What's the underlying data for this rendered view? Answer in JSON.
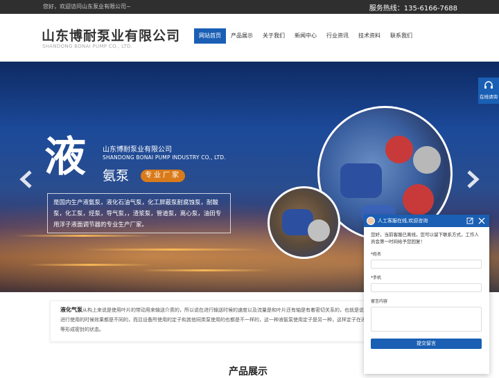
{
  "topbar": {
    "welcome": "您好，欢迎访问山东泵业有限公司~",
    "hotline": "服务热线：135-6166-7688"
  },
  "logo": {
    "cn": "山东博耐泵业有限公司",
    "en": "SHANDONG BONAI PUMP CO., LTD."
  },
  "nav": {
    "items": [
      "网站首页",
      "产品展示",
      "关于我们",
      "新闻中心",
      "行业资讯",
      "技术资料",
      "联系我们"
    ]
  },
  "banner": {
    "big_char": "液",
    "company_cn": "山东博耐泵业有限公司",
    "company_en": "SHANDONG BONAI PUMP INDUSTRY CO., LTD.",
    "subtitle": "氨泵",
    "badge": "专业厂家",
    "description": "是国内生产液氨泵，液化石油气泵，化工屏蔽泵耐腐蚀泵，耐酸泵，化工泵，烃泵，导气泵，，渣浆泵，管道泵，离心泵，油田专用浮子液面调节器的专业生产厂家。"
  },
  "side_service": {
    "label": "在线请询"
  },
  "intro": {
    "keyword": "液化气泵",
    "text": "从构上来说是使用叶片的带动用来输送介质的，所以说在进行输送时候的速度以及流量是和叶片还有轴是有着密切关系的，也就是说叶片或者是不同性质的叶片在进行使用的时候效果都是不同的，而且设备所使用的定子和其他同类泵使用的也都是不一样的，这一种液氨泵使用定子是另一种，这样定子在进行使用的时候就可以和转子等形成密封的状态。"
  },
  "section": {
    "title": "产品展示"
  },
  "chat": {
    "header": "人工客服在线,欢迎咨询",
    "note": "您好，当前客服已离线，您可以留下联系方式，工作人员会第一时间给予您回复！",
    "name_label": "*姓名",
    "phone_label": "*手机",
    "message_label": "留言内容",
    "submit": "提交留言"
  },
  "colors": {
    "brand": "#1a5fb4",
    "accent": "#d97b1a",
    "topbar": "#2f2f2f"
  }
}
